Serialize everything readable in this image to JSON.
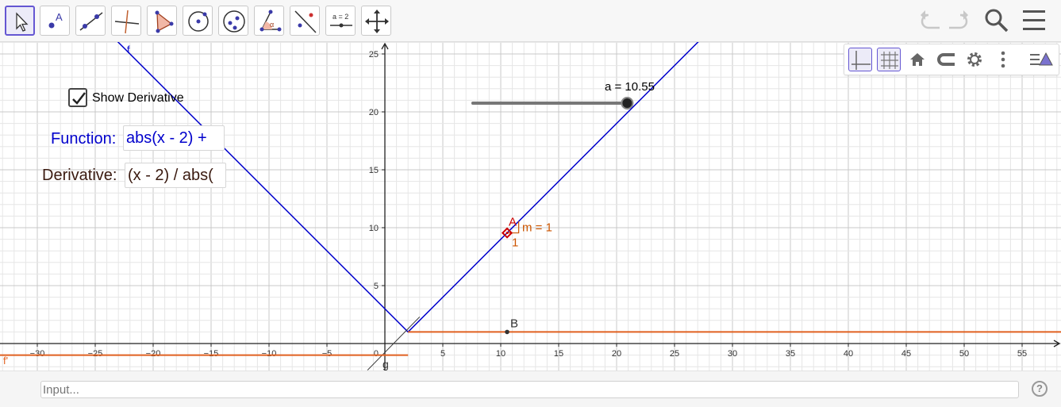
{
  "toolbar": {
    "tools": [
      {
        "name": "move-tool",
        "icon": "arrow-pointer-icon",
        "active": true
      },
      {
        "name": "point-tool",
        "icon": "point-icon",
        "glyph": "A"
      },
      {
        "name": "line-tool",
        "icon": "line-through-points-icon"
      },
      {
        "name": "perpendicular-line-tool",
        "icon": "perpendicular-line-icon"
      },
      {
        "name": "polygon-tool",
        "icon": "polygon-icon"
      },
      {
        "name": "circle-tool",
        "icon": "circle-center-point-icon"
      },
      {
        "name": "conic-tool",
        "icon": "ellipse-icon"
      },
      {
        "name": "angle-tool",
        "icon": "angle-icon",
        "glyph": "α"
      },
      {
        "name": "reflect-tool",
        "icon": "reflect-about-line-icon"
      },
      {
        "name": "slider-tool",
        "icon": "slider-icon",
        "glyph": "a = 2"
      },
      {
        "name": "move-graphics-view-tool",
        "icon": "move-graphics-view-icon"
      }
    ],
    "right": [
      "undo-icon",
      "redo-icon",
      "search-icon",
      "menu-icon"
    ]
  },
  "stylebar": {
    "buttons": [
      "axes-icon",
      "grid-icon",
      "home-icon",
      "point-capture-icon",
      "gear-icon",
      "more-vert-icon",
      "toggle-style-bar-icon"
    ]
  },
  "controls": {
    "show_derivative_label": "Show Derivative",
    "show_derivative_checked": true,
    "function_label": "Function:",
    "function_value": "abs(x - 2) +",
    "derivative_label": "Derivative:",
    "derivative_value": "(x - 2) / abs("
  },
  "slider": {
    "label": "a = 10.55",
    "value": 10.55,
    "min": -5,
    "max": 11
  },
  "labels": {
    "f": "f",
    "f_prime": "f'",
    "g": "g",
    "point_a": "A",
    "point_b": "B",
    "slope": "m = 1",
    "slope_run": "1"
  },
  "axes": {
    "x_ticks": [
      "−30",
      "−25",
      "−20",
      "−15",
      "−10",
      "−5",
      "0",
      "5",
      "10",
      "15",
      "20",
      "25",
      "30",
      "35",
      "40",
      "45",
      "50",
      "55"
    ],
    "y_ticks": [
      "5",
      "10",
      "15",
      "20",
      "25"
    ]
  },
  "colors": {
    "function": "#0000cc",
    "derivative": "#e06020",
    "point_a": "#cc0000",
    "slope_text": "#cc5500",
    "grid_minor": "#e6e6e6",
    "grid_major": "#c8c8c8",
    "accent": "#6557d2"
  },
  "input_bar": {
    "placeholder": "Input..."
  },
  "help_label": "?"
}
